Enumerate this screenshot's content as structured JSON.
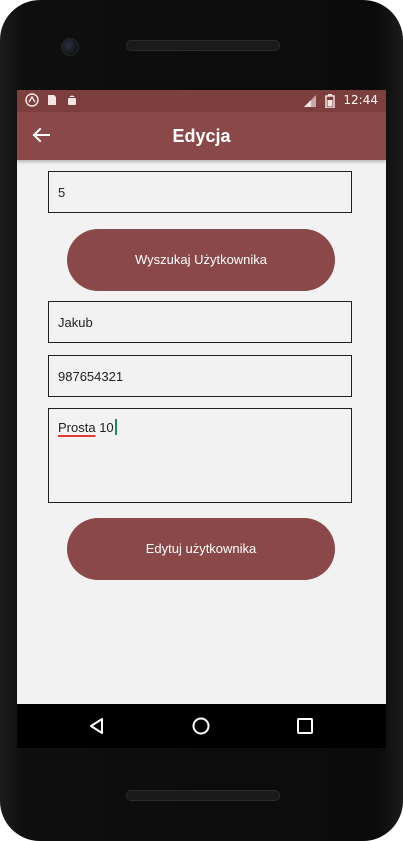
{
  "statusbar": {
    "time": "12:44",
    "left_icons": [
      "app-icon",
      "sim-icon",
      "android-icon"
    ],
    "right_icons": [
      "signal-icon",
      "battery-icon"
    ]
  },
  "appbar": {
    "title": "Edycja",
    "back_icon": "arrow-left-icon"
  },
  "form": {
    "id_value": "5",
    "search_button": "Wyszukaj Użytkownika",
    "name_value": "Jakub",
    "phone_value": "987654321",
    "address_value_word": "Prosta",
    "address_value_rest": " 10",
    "edit_button": "Edytuj użytkownika"
  },
  "navbar": {
    "buttons": [
      "back-triangle-icon",
      "home-circle-icon",
      "recents-square-icon"
    ]
  },
  "colors": {
    "accent": "#8a4849",
    "statusbar": "#7d3f3e",
    "background": "#f2f2f2"
  }
}
